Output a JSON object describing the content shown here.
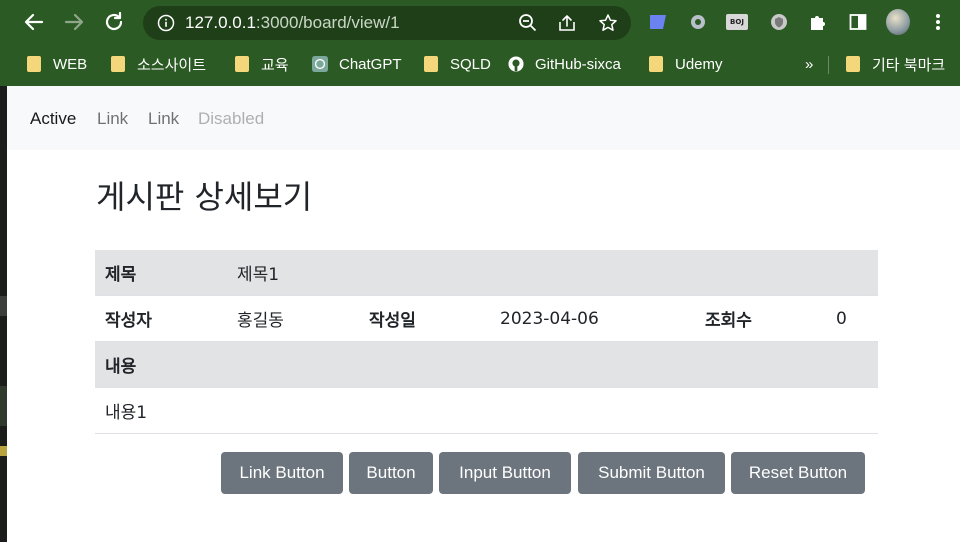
{
  "browser": {
    "url_host": "127.0.0.1",
    "url_rest": ":3000/board/view/1",
    "bookmarks": [
      {
        "label": "WEB",
        "icon": "folder-icon"
      },
      {
        "label": "소스사이트",
        "icon": "folder-icon"
      },
      {
        "label": "교육",
        "icon": "folder-icon"
      },
      {
        "label": "ChatGPT",
        "icon": "chatgpt-icon"
      },
      {
        "label": "SQLD",
        "icon": "folder-icon"
      },
      {
        "label": "GitHub-sixca",
        "icon": "github-icon"
      },
      {
        "label": "Udemy",
        "icon": "folder-icon"
      }
    ],
    "overflow": "»",
    "other_bookmarks": "기타 북마크",
    "ext_boj": "BOJ",
    "theme_color": "#2b5a24"
  },
  "navbar": {
    "links": [
      "Active",
      "Link",
      "Link",
      "Disabled"
    ]
  },
  "page": {
    "title": "게시판 상세보기"
  },
  "board": {
    "title_label": "제목",
    "title_value": "제목1",
    "author_label": "작성자",
    "author_value": "홍길동",
    "date_label": "작성일",
    "date_value": "2023-04-06",
    "views_label": "조회수",
    "views_value": "0",
    "content_label": "내용",
    "content_value": "내용1"
  },
  "buttons": {
    "link_button": "Link Button",
    "button": "Button",
    "input_button": "Input Button",
    "submit_button": "Submit Button",
    "reset_button": "Reset Button"
  }
}
